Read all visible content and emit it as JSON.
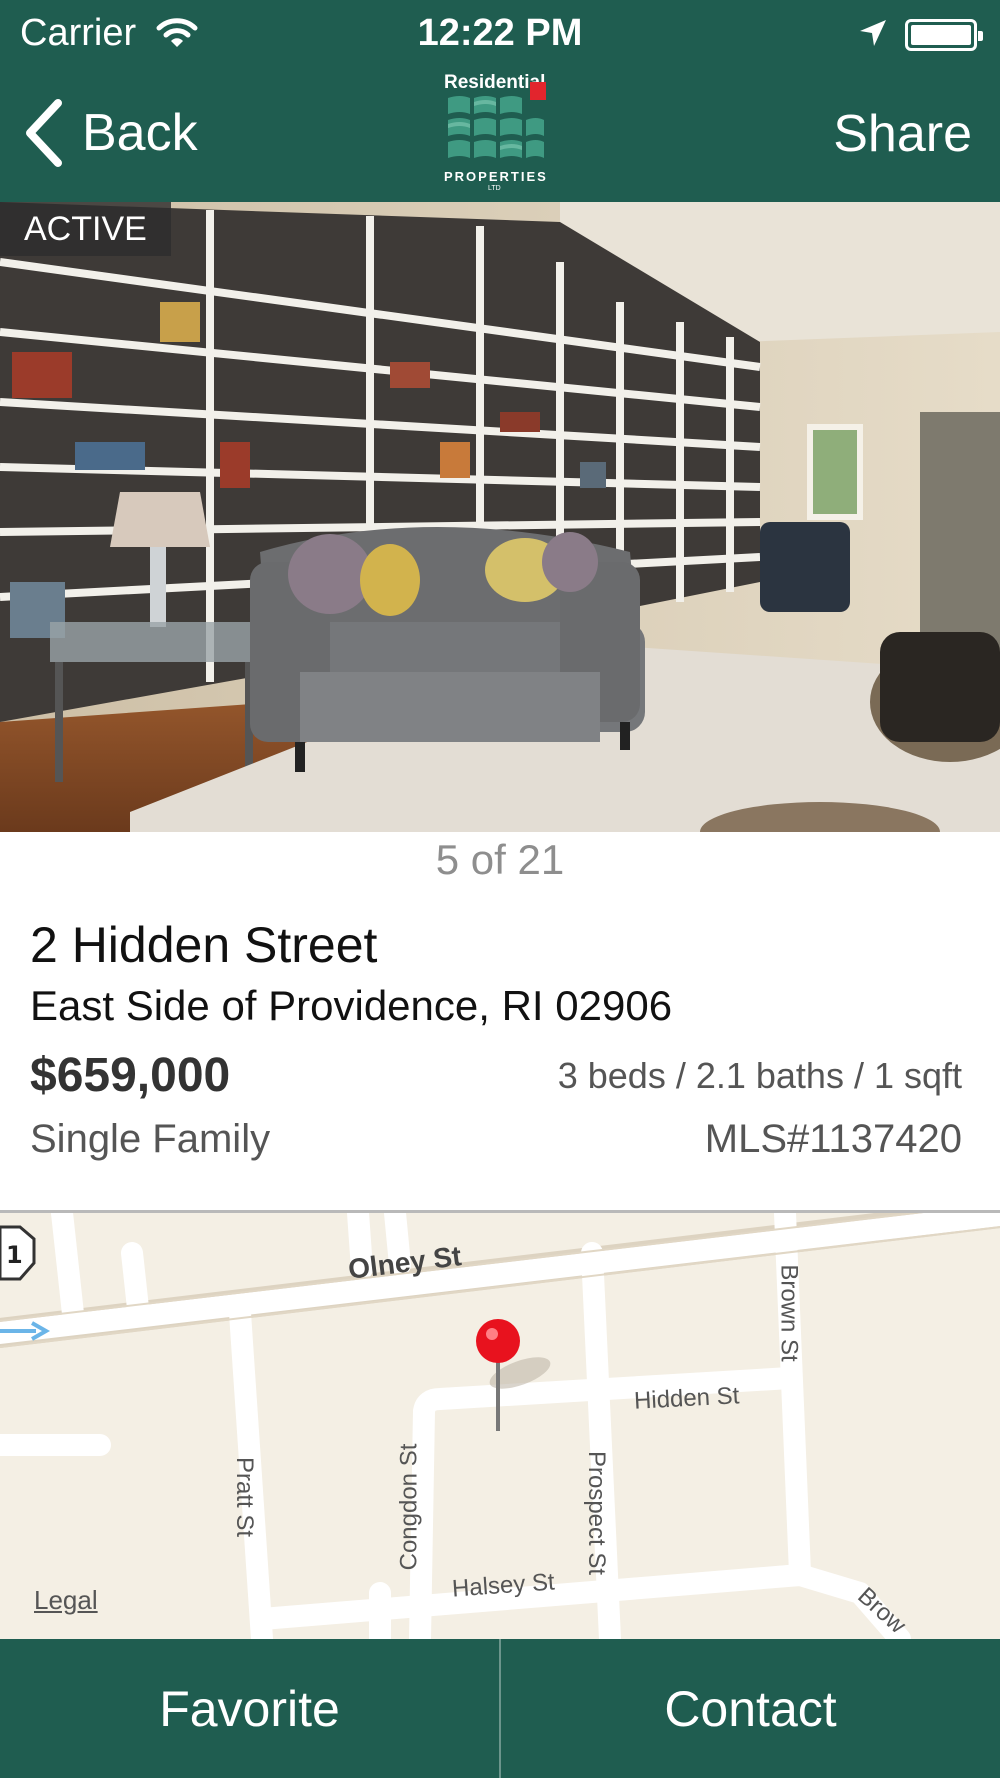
{
  "status_bar": {
    "carrier": "Carrier",
    "time": "12:22 PM"
  },
  "nav": {
    "back_label": "Back",
    "share_label": "Share"
  },
  "logo": {
    "top": "Residential",
    "bottom": "PROPERTIES",
    "ltd": "LTD"
  },
  "photo": {
    "badge": "ACTIVE",
    "counter": "5 of 21"
  },
  "listing": {
    "address": "2 Hidden Street",
    "area": "East Side of Providence, RI 02906",
    "price": "$659,000",
    "specs": "3 beds / 2.1 baths / 1 sqft",
    "property_type": "Single Family",
    "mls": "MLS#1137420"
  },
  "map": {
    "streets": {
      "olney": "Olney St",
      "brown": "Brown St",
      "hidden": "Hidden St",
      "pratt": "Pratt St",
      "congdon": "Congdon St",
      "prospect": "Prospect St",
      "halsey": "Halsey St",
      "brown_lower": "Brow"
    },
    "legal_label": "Legal",
    "pin_color": "#e8121e"
  },
  "actions": {
    "favorite_label": "Favorite",
    "contact_label": "Contact"
  },
  "colors": {
    "brand": "#1f5d50",
    "map_bg": "#f4efe4",
    "road": "#ffffff"
  }
}
